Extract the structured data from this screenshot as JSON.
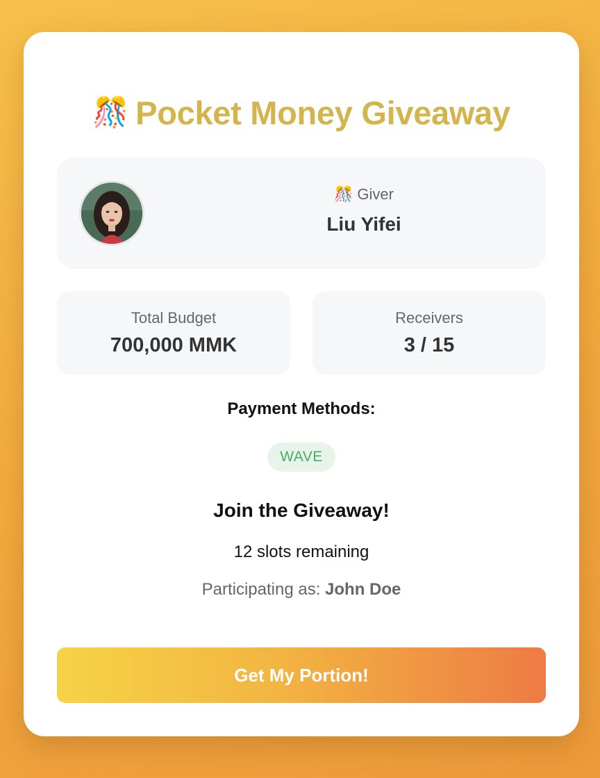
{
  "header": {
    "title_emoji": "🎊",
    "title": "Pocket Money Giveaway"
  },
  "giver": {
    "label_emoji": "🎊",
    "label": "Giver",
    "name": "Liu Yifei"
  },
  "stats": {
    "budget_label": "Total Budget",
    "budget_value": "700,000 MMK",
    "receivers_label": "Receivers",
    "receivers_value": "3 / 15"
  },
  "payment": {
    "title": "Payment Methods:",
    "methods": [
      "WAVE"
    ]
  },
  "join": {
    "title": "Join the Giveaway!",
    "slots": "12 slots remaining",
    "participating_prefix": "Participating as:",
    "participant_name": "John Doe"
  },
  "cta": {
    "label": "Get My Portion!"
  },
  "colors": {
    "title": "#d4b44c",
    "badge_bg": "#e8f4ea",
    "badge_text": "#4fa863",
    "cta_start": "#f6d346",
    "cta_end": "#ee7b44"
  }
}
